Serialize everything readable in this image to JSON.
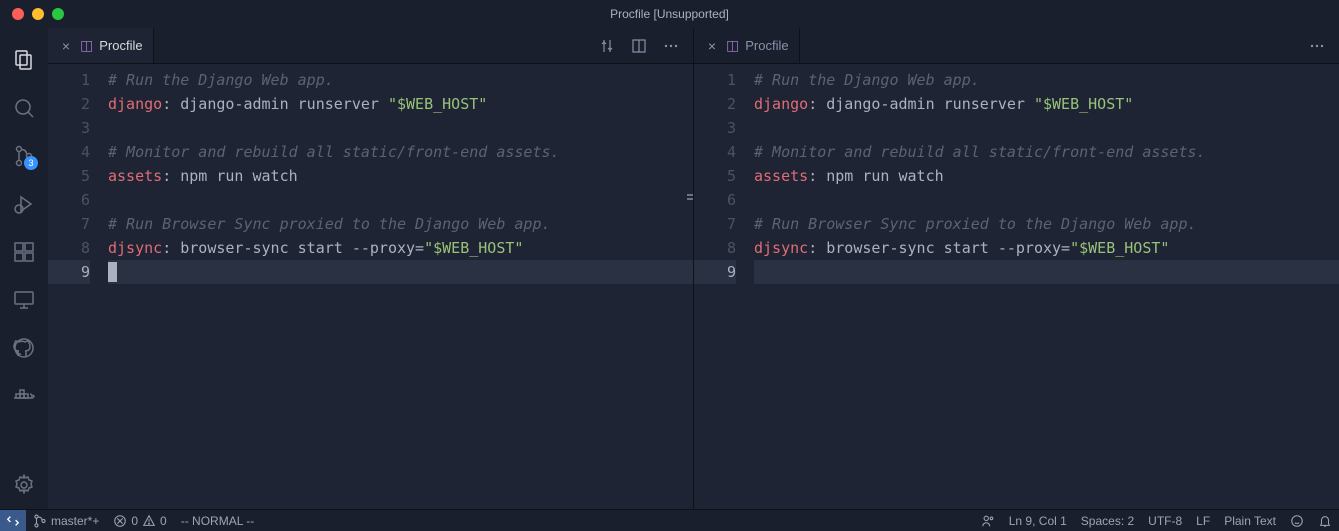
{
  "window": {
    "title": "Procfile [Unsupported]"
  },
  "tabs": {
    "left": {
      "name": "Procfile"
    },
    "right": {
      "name": "Procfile"
    }
  },
  "scm_badge": "3",
  "code": {
    "l1_comment": "# Run the Django Web app.",
    "l2_key": "django",
    "l2_rest": ": django-admin runserver ",
    "l2_str": "\"$WEB_HOST\"",
    "l4_comment": "# Monitor and rebuild all static/front-end assets.",
    "l5_key": "assets",
    "l5_rest": ": npm run watch",
    "l7_comment": "# Run Browser Sync proxied to the Django Web app.",
    "l8_key": "djsync",
    "l8_rest": ": browser-sync start --proxy=",
    "l8_str": "\"$WEB_HOST\"",
    "ln1": "1",
    "ln2": "2",
    "ln3": "3",
    "ln4": "4",
    "ln5": "5",
    "ln6": "6",
    "ln7": "7",
    "ln8": "8",
    "ln9": "9"
  },
  "status": {
    "branch": "master*+",
    "errors": "0",
    "warnings": "0",
    "vim_mode": "-- NORMAL --",
    "cursor": "Ln 9, Col 1",
    "spaces": "Spaces: 2",
    "encoding": "UTF-8",
    "eol": "LF",
    "lang": "Plain Text"
  }
}
